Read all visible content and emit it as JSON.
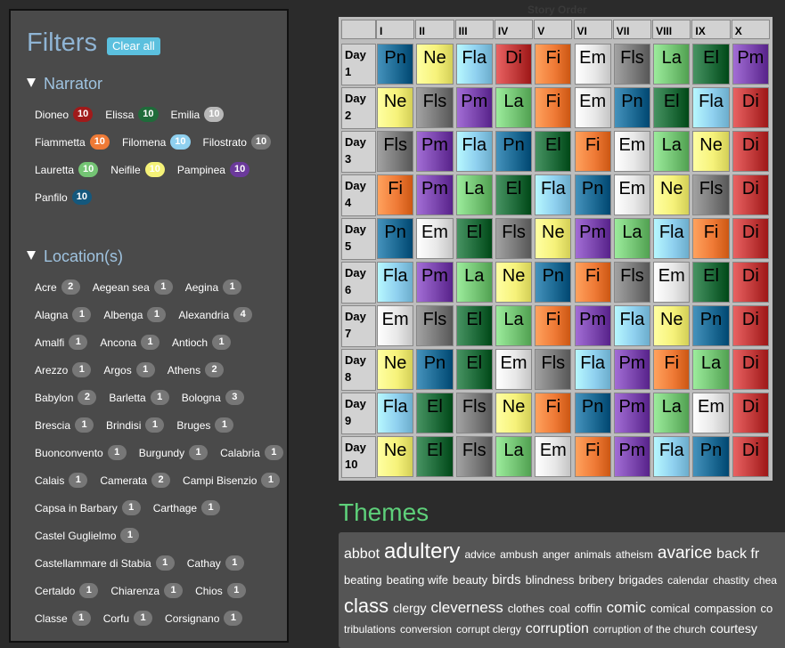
{
  "sidebar": {
    "title": "Filters",
    "clear_label": "Clear all",
    "narrator_heading": "Narrator",
    "location_heading": "Location(s)",
    "narrators": [
      {
        "name": "Dioneo",
        "count": "10",
        "color": "#a01a1a",
        "text": "#fff"
      },
      {
        "name": "Elissa",
        "count": "10",
        "color": "#1f6b3a",
        "text": "#fff"
      },
      {
        "name": "Emilia",
        "count": "10",
        "color": "#b8b8b8",
        "text": "#fff"
      },
      {
        "name": "Fiammetta",
        "count": "10",
        "color": "#ef7a36",
        "text": "#fff"
      },
      {
        "name": "Filomena",
        "count": "10",
        "color": "#8fd0ef",
        "text": "#fff"
      },
      {
        "name": "Filostrato",
        "count": "10",
        "color": "#777777",
        "text": "#fff"
      },
      {
        "name": "Lauretta",
        "count": "10",
        "color": "#74c474",
        "text": "#fff"
      },
      {
        "name": "Neifile",
        "count": "10",
        "color": "#f5f278",
        "text": "#fff"
      },
      {
        "name": "Pampinea",
        "count": "10",
        "color": "#6b3a9b",
        "text": "#fff"
      },
      {
        "name": "Panfilo",
        "count": "10",
        "color": "#14587d",
        "text": "#fff"
      }
    ],
    "locations": [
      {
        "name": "Acre",
        "count": "2"
      },
      {
        "name": "Aegean sea",
        "count": "1"
      },
      {
        "name": "Aegina",
        "count": "1"
      },
      {
        "name": "Alagna",
        "count": "1"
      },
      {
        "name": "Albenga",
        "count": "1"
      },
      {
        "name": "Alexandria",
        "count": "4"
      },
      {
        "name": "Amalfi",
        "count": "1"
      },
      {
        "name": "Ancona",
        "count": "1"
      },
      {
        "name": "Antioch",
        "count": "1"
      },
      {
        "name": "Arezzo",
        "count": "1"
      },
      {
        "name": "Argos",
        "count": "1"
      },
      {
        "name": "Athens",
        "count": "2"
      },
      {
        "name": "Babylon",
        "count": "2"
      },
      {
        "name": "Barletta",
        "count": "1"
      },
      {
        "name": "Bologna",
        "count": "3"
      },
      {
        "name": "Brescia",
        "count": "1"
      },
      {
        "name": "Brindisi",
        "count": "1"
      },
      {
        "name": "Bruges",
        "count": "1"
      },
      {
        "name": "Buonconvento",
        "count": "1"
      },
      {
        "name": "Burgundy",
        "count": "1"
      },
      {
        "name": "Calabria",
        "count": "1"
      },
      {
        "name": "Calais",
        "count": "1"
      },
      {
        "name": "Camerata",
        "count": "2"
      },
      {
        "name": "Campi Bisenzio",
        "count": "1"
      },
      {
        "name": "Capsa in Barbary",
        "count": "1"
      },
      {
        "name": "Carthage",
        "count": "1"
      },
      {
        "name": "Castel Guglielmo",
        "count": "1"
      },
      {
        "name": "Castellammare di Stabia",
        "count": "1"
      },
      {
        "name": "Cathay",
        "count": "1"
      },
      {
        "name": "Certaldo",
        "count": "1"
      },
      {
        "name": "Chiarenza",
        "count": "1"
      },
      {
        "name": "Chios",
        "count": "1"
      },
      {
        "name": "Classe",
        "count": "1"
      },
      {
        "name": "Corfu",
        "count": "1"
      },
      {
        "name": "Corsignano",
        "count": "1"
      }
    ]
  },
  "grid": {
    "title": "Story Order",
    "columns": [
      "I",
      "II",
      "III",
      "IV",
      "V",
      "VI",
      "VII",
      "VIII",
      "IX",
      "X"
    ],
    "day_word": "Day",
    "days": [
      "1",
      "2",
      "3",
      "4",
      "5",
      "6",
      "7",
      "8",
      "9",
      "10"
    ],
    "rows": [
      [
        "Pn",
        "Ne",
        "Fla",
        "Di",
        "Fi",
        "Em",
        "Fls",
        "La",
        "El",
        "Pm"
      ],
      [
        "Ne",
        "Fls",
        "Pm",
        "La",
        "Fi",
        "Em",
        "Pn",
        "El",
        "Fla",
        "Di"
      ],
      [
        "Fls",
        "Pm",
        "Fla",
        "Pn",
        "El",
        "Fi",
        "Em",
        "La",
        "Ne",
        "Di"
      ],
      [
        "Fi",
        "Pm",
        "La",
        "El",
        "Fla",
        "Pn",
        "Em",
        "Ne",
        "Fls",
        "Di"
      ],
      [
        "Pn",
        "Em",
        "El",
        "Fls",
        "Ne",
        "Pm",
        "La",
        "Fla",
        "Fi",
        "Di"
      ],
      [
        "Fla",
        "Pm",
        "La",
        "Ne",
        "Pn",
        "Fi",
        "Fls",
        "Em",
        "El",
        "Di"
      ],
      [
        "Em",
        "Fls",
        "El",
        "La",
        "Fi",
        "Pm",
        "Fla",
        "Ne",
        "Pn",
        "Di"
      ],
      [
        "Ne",
        "Pn",
        "El",
        "Em",
        "Fls",
        "Fla",
        "Pm",
        "Fi",
        "La",
        "Di"
      ],
      [
        "Fla",
        "El",
        "Fls",
        "Ne",
        "Fi",
        "Pn",
        "Pm",
        "La",
        "Em",
        "Di"
      ],
      [
        "Ne",
        "El",
        "Fls",
        "La",
        "Em",
        "Fi",
        "Pm",
        "Fla",
        "Pn",
        "Di"
      ]
    ],
    "colors": {
      "Pn": "#1d6a94",
      "Ne": "#f6f27a",
      "Fla": "#8fd0ef",
      "Di": "#c13a3a",
      "Fi": "#ef7a36",
      "Em": "#e8e8e8",
      "Fls": "#7a7a7a",
      "La": "#74c474",
      "El": "#1f6b3a",
      "Pm": "#7a45ad"
    }
  },
  "themes": {
    "title": "Themes",
    "lines": [
      [
        {
          "w": "abbot",
          "s": 16
        },
        {
          "w": "adultery",
          "s": 24
        },
        {
          "w": "advice",
          "s": 12
        },
        {
          "w": "ambush",
          "s": 12
        },
        {
          "w": "anger",
          "s": 12
        },
        {
          "w": "animals",
          "s": 12
        },
        {
          "w": "atheism",
          "s": 12
        },
        {
          "w": "avarice",
          "s": 19
        },
        {
          "w": "back fr",
          "s": 16
        }
      ],
      [
        {
          "w": "beating",
          "s": 13
        },
        {
          "w": "beating wife",
          "s": 13
        },
        {
          "w": "beauty",
          "s": 13
        },
        {
          "w": "birds",
          "s": 15
        },
        {
          "w": "blindness",
          "s": 13
        },
        {
          "w": "bribery",
          "s": 13
        },
        {
          "w": "brigades",
          "s": 13
        },
        {
          "w": "calendar",
          "s": 12
        },
        {
          "w": "chastity",
          "s": 12
        },
        {
          "w": "chea",
          "s": 12
        }
      ],
      [
        {
          "w": "class",
          "s": 22
        },
        {
          "w": "clergy",
          "s": 14
        },
        {
          "w": "cleverness",
          "s": 17
        },
        {
          "w": "clothes",
          "s": 13
        },
        {
          "w": "coal",
          "s": 13
        },
        {
          "w": "coffin",
          "s": 13
        },
        {
          "w": "comic",
          "s": 17
        },
        {
          "w": "comical",
          "s": 13
        },
        {
          "w": "compassion",
          "s": 13
        },
        {
          "w": "co",
          "s": 13
        }
      ],
      [
        {
          "w": "tribulations",
          "s": 12
        },
        {
          "w": "conversion",
          "s": 12
        },
        {
          "w": "corrupt clergy",
          "s": 12
        },
        {
          "w": "corruption",
          "s": 16
        },
        {
          "w": "corruption of the church",
          "s": 12
        },
        {
          "w": "courtesy",
          "s": 14
        }
      ]
    ]
  }
}
